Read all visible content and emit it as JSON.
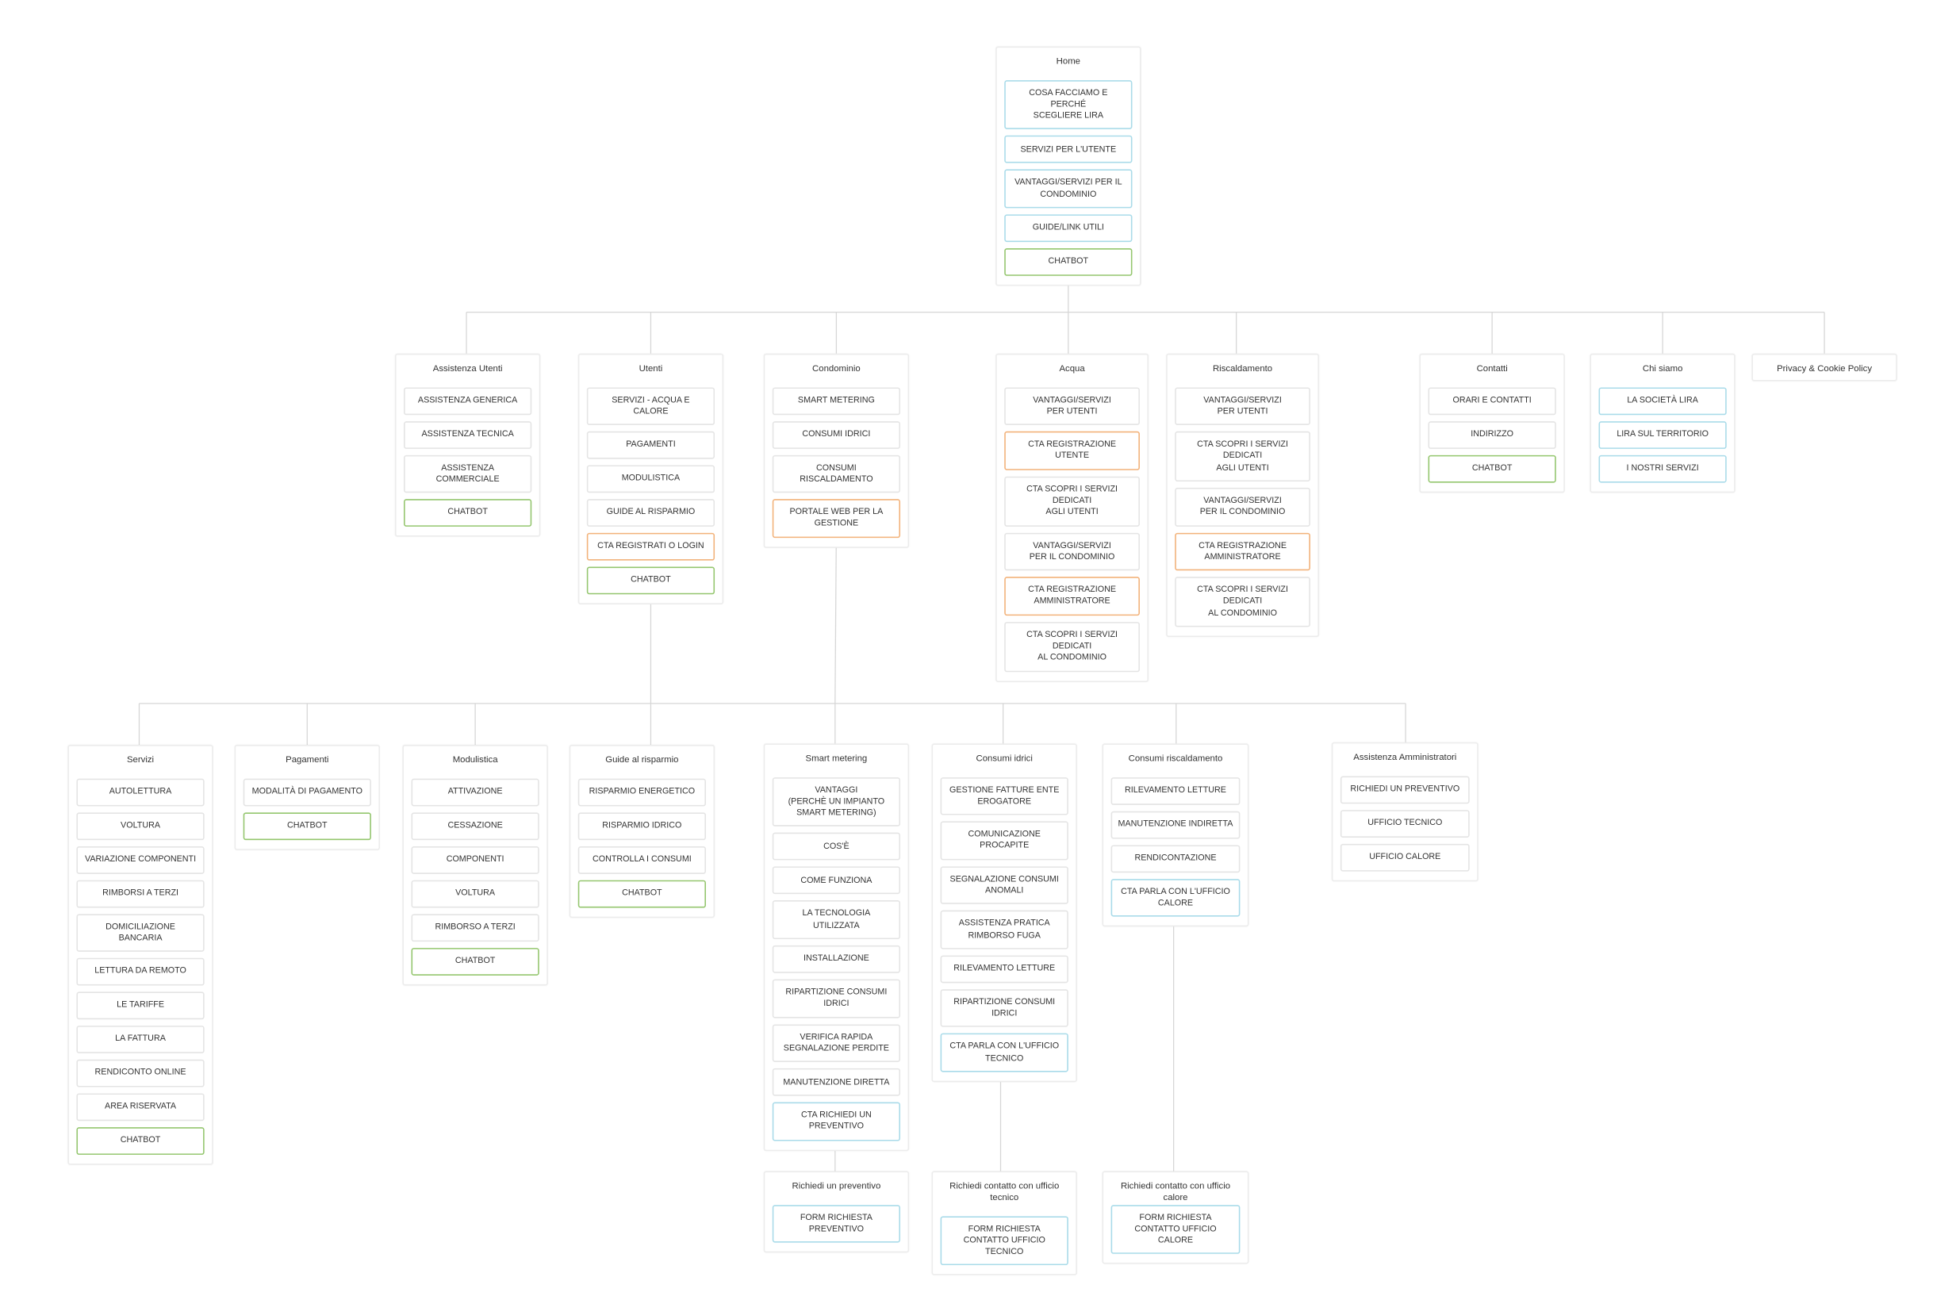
{
  "colors": {
    "default": "#e4e4e4",
    "blue": "#a9dbe9",
    "green": "#94c66e",
    "orange": "#f2b27a",
    "connector": "#d6d6d6"
  },
  "nodes": [
    {
      "id": "home",
      "title": "Home",
      "items": [
        {
          "label": "COSA FACCIAMO E PERCHÉ\nSCEGLIERE LIRA",
          "type": "blue"
        },
        {
          "label": "SERVIZI PER L'UTENTE",
          "type": "blue"
        },
        {
          "label": "VANTAGGI/SERVIZI PER IL\nCONDOMINIO",
          "type": "blue"
        },
        {
          "label": "GUIDE/LINK UTILI",
          "type": "blue"
        },
        {
          "label": "CHATBOT",
          "type": "green"
        }
      ]
    },
    {
      "id": "assistenza-utenti",
      "title": "Assistenza Utenti",
      "items": [
        {
          "label": "ASSISTENZA GENERICA",
          "type": "default"
        },
        {
          "label": "ASSISTENZA TECNICA",
          "type": "default"
        },
        {
          "label": "ASSISTENZA COMMERCIALE",
          "type": "default"
        },
        {
          "label": "CHATBOT",
          "type": "green"
        }
      ]
    },
    {
      "id": "utenti",
      "title": "Utenti",
      "items": [
        {
          "label": "SERVIZI - ACQUA E CALORE",
          "type": "default"
        },
        {
          "label": "PAGAMENTI",
          "type": "default"
        },
        {
          "label": "MODULISTICA",
          "type": "default"
        },
        {
          "label": "GUIDE AL RISPARMIO",
          "type": "default"
        },
        {
          "label": "CTA REGISTRATI O LOGIN",
          "type": "orange"
        },
        {
          "label": "CHATBOT",
          "type": "green"
        }
      ]
    },
    {
      "id": "condominio",
      "title": "Condominio",
      "items": [
        {
          "label": "SMART METERING",
          "type": "default"
        },
        {
          "label": "CONSUMI IDRICI",
          "type": "default"
        },
        {
          "label": "CONSUMI RISCALDAMENTO",
          "type": "default"
        },
        {
          "label": "PORTALE WEB PER LA\nGESTIONE",
          "type": "orange"
        }
      ]
    },
    {
      "id": "acqua",
      "title": "Acqua",
      "items": [
        {
          "label": "VANTAGGI/SERVIZI\nPER UTENTI",
          "type": "default"
        },
        {
          "label": "CTA REGISTRAZIONE UTENTE",
          "type": "orange"
        },
        {
          "label": "CTA SCOPRI I SERVIZI DEDICATI\nAGLI UTENTI",
          "type": "default"
        },
        {
          "label": "VANTAGGI/SERVIZI\nPER IL CONDOMINIO",
          "type": "default"
        },
        {
          "label": "CTA REGISTRAZIONE\nAMMINISTRATORE",
          "type": "orange"
        },
        {
          "label": "CTA SCOPRI I SERVIZI DEDICATI\nAL CONDOMINIO",
          "type": "default"
        }
      ]
    },
    {
      "id": "riscaldamento",
      "title": "Riscaldamento",
      "items": [
        {
          "label": "VANTAGGI/SERVIZI\nPER UTENTI",
          "type": "default"
        },
        {
          "label": "CTA SCOPRI I SERVIZI DEDICATI\nAGLI UTENTI",
          "type": "default"
        },
        {
          "label": "VANTAGGI/SERVIZI\nPER IL CONDOMINIO",
          "type": "default"
        },
        {
          "label": "CTA REGISTRAZIONE\nAMMINISTRATORE",
          "type": "orange"
        },
        {
          "label": "CTA SCOPRI I SERVIZI DEDICATI\nAL CONDOMINIO",
          "type": "default"
        }
      ]
    },
    {
      "id": "contatti",
      "title": "Contatti",
      "items": [
        {
          "label": "ORARI E CONTATTI",
          "type": "default"
        },
        {
          "label": "INDIRIZZO",
          "type": "default"
        },
        {
          "label": "CHATBOT",
          "type": "green"
        }
      ]
    },
    {
      "id": "chi-siamo",
      "title": "Chi siamo",
      "items": [
        {
          "label": "LA SOCIETÀ LIRA",
          "type": "blue"
        },
        {
          "label": "LIRA SUL TERRITORIO",
          "type": "blue"
        },
        {
          "label": "I NOSTRI SERVIZI",
          "type": "blue"
        }
      ]
    },
    {
      "id": "privacy",
      "title": "Privacy & Cookie Policy",
      "items": []
    },
    {
      "id": "servizi",
      "title": "Servizi",
      "items": [
        {
          "label": "AUTOLETTURA",
          "type": "default"
        },
        {
          "label": "VOLTURA",
          "type": "default"
        },
        {
          "label": "VARIAZIONE COMPONENTI",
          "type": "default"
        },
        {
          "label": "RIMBORSI A TERZI",
          "type": "default"
        },
        {
          "label": "DOMICILIAZIONE BANCARIA",
          "type": "default"
        },
        {
          "label": "LETTURA DA REMOTO",
          "type": "default"
        },
        {
          "label": "LE TARIFFE",
          "type": "default"
        },
        {
          "label": "LA FATTURA",
          "type": "default"
        },
        {
          "label": "RENDICONTO ONLINE",
          "type": "default"
        },
        {
          "label": "AREA RISERVATA",
          "type": "default"
        },
        {
          "label": "CHATBOT",
          "type": "green"
        }
      ]
    },
    {
      "id": "pagamenti",
      "title": "Pagamenti",
      "items": [
        {
          "label": "MODALITÀ DI PAGAMENTO",
          "type": "default"
        },
        {
          "label": "CHATBOT",
          "type": "green"
        }
      ]
    },
    {
      "id": "modulistica",
      "title": "Modulistica",
      "items": [
        {
          "label": "ATTIVAZIONE",
          "type": "default"
        },
        {
          "label": "CESSAZIONE",
          "type": "default"
        },
        {
          "label": "COMPONENTI",
          "type": "default"
        },
        {
          "label": "VOLTURA",
          "type": "default"
        },
        {
          "label": "RIMBORSO A TERZI",
          "type": "default"
        },
        {
          "label": "CHATBOT",
          "type": "green"
        }
      ]
    },
    {
      "id": "guide-risparmio",
      "title": "Guide al risparmio",
      "items": [
        {
          "label": "RISPARMIO ENERGETICO",
          "type": "default"
        },
        {
          "label": "RISPARMIO IDRICO",
          "type": "default"
        },
        {
          "label": "CONTROLLA I CONSUMI",
          "type": "default"
        },
        {
          "label": "CHATBOT",
          "type": "green"
        }
      ]
    },
    {
      "id": "smart-metering",
      "title": "Smart metering",
      "items": [
        {
          "label": "VANTAGGI\n(PERCHÈ UN IMPIANTO\nSMART METERING)",
          "type": "default"
        },
        {
          "label": "COS'È",
          "type": "default"
        },
        {
          "label": "COME FUNZIONA",
          "type": "default"
        },
        {
          "label": "LA TECNOLOGIA\nUTILIZZATA",
          "type": "default"
        },
        {
          "label": "INSTALLAZIONE",
          "type": "default"
        },
        {
          "label": "RIPARTIZIONE CONSUMI\nIDRICI",
          "type": "default"
        },
        {
          "label": "VERIFICA RAPIDA\nSEGNALAZIONE PERDITE",
          "type": "default"
        },
        {
          "label": "MANUTENZIONE DIRETTA",
          "type": "default"
        },
        {
          "label": "CTA RICHIEDI UN\nPREVENTIVO",
          "type": "blue"
        }
      ]
    },
    {
      "id": "consumi-idrici",
      "title": "Consumi idrici",
      "items": [
        {
          "label": "GESTIONE FATTURE ENTE\nEROGATORE",
          "type": "default"
        },
        {
          "label": "COMUNICAZIONE\nPROCAPITE",
          "type": "default"
        },
        {
          "label": "SEGNALAZIONE CONSUMI\nANOMALI",
          "type": "default"
        },
        {
          "label": "ASSISTENZA PRATICA\nRIMBORSO FUGA",
          "type": "default"
        },
        {
          "label": "RILEVAMENTO LETTURE",
          "type": "default"
        },
        {
          "label": "RIPARTIZIONE CONSUMI\nIDRICI",
          "type": "default"
        },
        {
          "label": "CTA PARLA CON L'UFFICIO\nTECNICO",
          "type": "blue"
        }
      ]
    },
    {
      "id": "consumi-riscaldamento",
      "title": "Consumi riscaldamento",
      "items": [
        {
          "label": "RILEVAMENTO LETTURE",
          "type": "default"
        },
        {
          "label": "MANUTENZIONE INDIRETTA",
          "type": "default"
        },
        {
          "label": "RENDICONTAZIONE",
          "type": "default"
        },
        {
          "label": "CTA PARLA CON L'UFFICIO\nCALORE",
          "type": "blue"
        }
      ]
    },
    {
      "id": "assistenza-amministratori",
      "title": "Assistenza Amministratori",
      "items": [
        {
          "label": "RICHIEDI UN PREVENTIVO",
          "type": "default"
        },
        {
          "label": "UFFICIO TECNICO",
          "type": "default"
        },
        {
          "label": "UFFICIO CALORE",
          "type": "default"
        }
      ]
    },
    {
      "id": "richiedi-preventivo",
      "title": "Richiedi un preventivo",
      "items": [
        {
          "label": "FORM RICHIESTA\nPREVENTIVO",
          "type": "blue"
        }
      ]
    },
    {
      "id": "richiedi-contatto-tecnico",
      "title": "Richiedi contatto con ufficio\ntecnico",
      "items": [
        {
          "label": "FORM RICHIESTA\nCONTATTO UFFICIO\nTECNICO",
          "type": "blue"
        }
      ]
    },
    {
      "id": "richiedi-contatto-calore",
      "title": "Richiedi contatto con ufficio calore",
      "items": [
        {
          "label": "FORM RICHIESTA\nCONTATTO UFFICIO CALORE",
          "type": "blue"
        }
      ]
    }
  ]
}
